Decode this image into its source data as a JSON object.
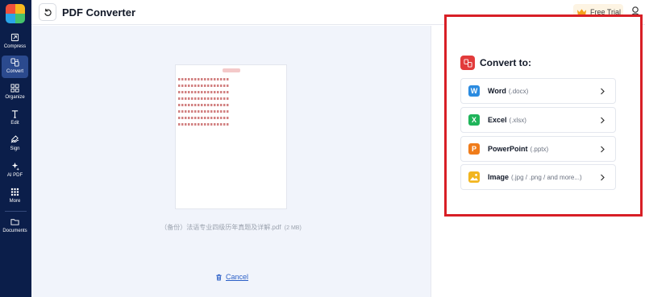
{
  "app": {
    "title": "PDF Converter"
  },
  "sidebar": {
    "items": [
      {
        "label": "Compress",
        "icon": "compress-icon"
      },
      {
        "label": "Convert",
        "icon": "convert-icon",
        "active": true
      },
      {
        "label": "Organize",
        "icon": "organize-icon"
      },
      {
        "label": "Edit",
        "icon": "edit-icon"
      },
      {
        "label": "Sign",
        "icon": "sign-icon"
      },
      {
        "label": "AI PDF",
        "icon": "ai-sparkle-icon"
      },
      {
        "label": "More",
        "icon": "grid-icon"
      },
      {
        "label": "Documents",
        "icon": "folder-icon"
      }
    ]
  },
  "header": {
    "free_trial_label": "Free Trial"
  },
  "preview": {
    "filename": "（备份）法语专业四级历年真题及详解.pdf",
    "filesize": "(2 MB)",
    "cancel_label": "Cancel"
  },
  "convert": {
    "heading": "Convert to:",
    "options": [
      {
        "name": "Word",
        "ext": "(.docx)",
        "badge": "W",
        "color": "#2b8be0"
      },
      {
        "name": "Excel",
        "ext": "(.xlsx)",
        "badge": "X",
        "color": "#1fb45a"
      },
      {
        "name": "PowerPoint",
        "ext": "(.pptx)",
        "badge": "P",
        "color": "#f07c1a"
      },
      {
        "name": "Image",
        "ext": "(.jpg / .png / and more...)",
        "badge": "",
        "color": "#f2b51e"
      }
    ]
  },
  "colors": {
    "sidebar_bg": "#0b1e4a",
    "highlight_border": "#d81f26",
    "link": "#2b5fc7"
  }
}
